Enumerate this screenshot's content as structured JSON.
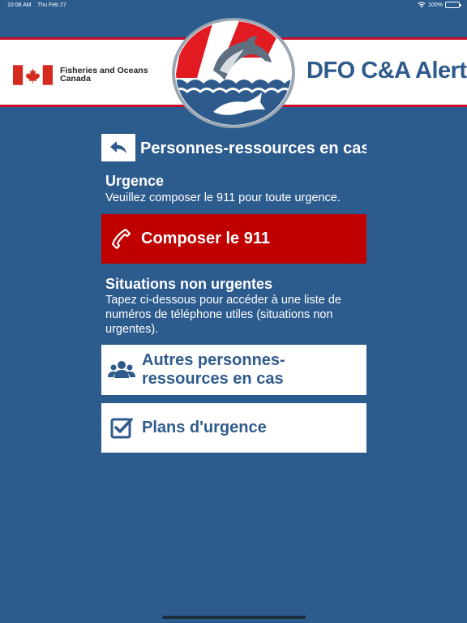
{
  "status_bar": {
    "time": "10:08 AM",
    "date": "Thu Feb 27",
    "battery": "100%"
  },
  "banner": {
    "dept_line1": "Fisheries and Oceans",
    "dept_line2": "Canada",
    "app_name": "DFO C&A Alert"
  },
  "page": {
    "title": "Personnes-ressources en cas"
  },
  "urgent": {
    "title": "Urgence",
    "text": "Veuillez composer le 911 pour toute urgence.",
    "call_label": "Composer le 911"
  },
  "non_urgent": {
    "title": "Situations non urgentes",
    "text": "Tapez ci-dessous pour accéder à une liste de numéros de téléphone utiles (situations non urgentes)."
  },
  "buttons": {
    "contacts_line1": "Autres personnes-",
    "contacts_line2": "ressources en cas",
    "plans": "Plans d'urgence"
  },
  "colors": {
    "background": "#2c5b8e",
    "accent_red": "#c00000",
    "brand_blue": "#2f5b8c"
  }
}
